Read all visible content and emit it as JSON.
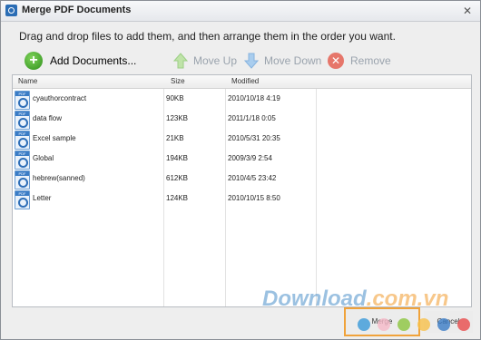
{
  "window": {
    "title": "Merge PDF Documents",
    "close_glyph": "✕"
  },
  "instruction": "Drag and drop files to add them, and then arrange them in the order you want.",
  "toolbar": {
    "add_label": "Add Documents...",
    "move_up_label": "Move Up",
    "move_down_label": "Move Down",
    "remove_label": "Remove"
  },
  "table": {
    "columns": [
      "Name",
      "Size",
      "Modified"
    ],
    "rows": [
      {
        "name": "cyauthorcontract",
        "size": "90KB",
        "modified": "2010/10/18 4:19"
      },
      {
        "name": "data flow",
        "size": "123KB",
        "modified": "2011/1/18 0:05"
      },
      {
        "name": "Excel sample",
        "size": "21KB",
        "modified": "2010/5/31 20:35"
      },
      {
        "name": "Global",
        "size": "194KB",
        "modified": "2009/3/9 2:54"
      },
      {
        "name": "hebrew(sanned)",
        "size": "612KB",
        "modified": "2010/4/5 23:42"
      },
      {
        "name": "Letter",
        "size": "124KB",
        "modified": "2010/10/15 8:50"
      }
    ]
  },
  "footer": {
    "merge_label": "Merge",
    "cancel_label": "Cancel"
  },
  "watermark": {
    "text": "Download",
    "suffix": ".com.vn"
  },
  "colors": {
    "accent": "#f0a23a",
    "pdf_blue": "#3a7cc6",
    "watermark": "#4a8fc9"
  }
}
